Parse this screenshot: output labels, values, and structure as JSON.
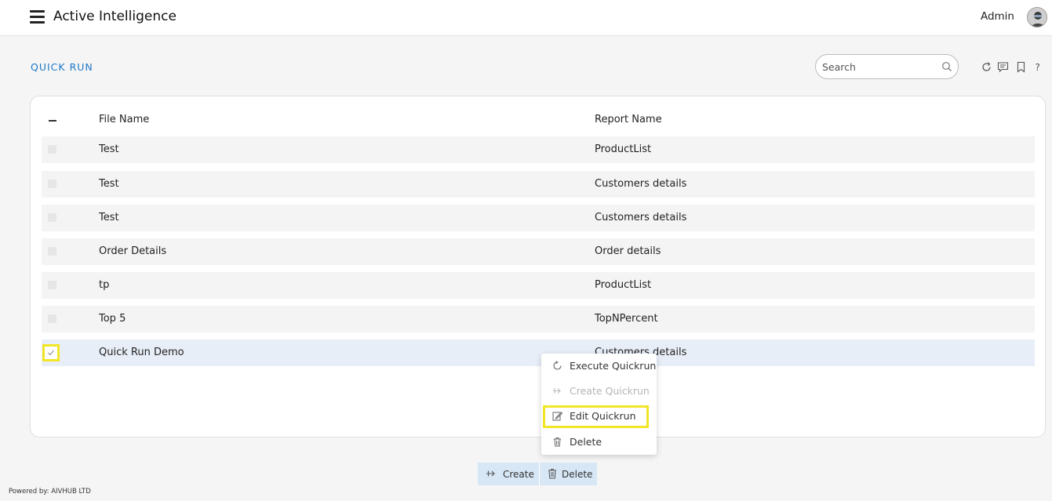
{
  "header": {
    "app_title": "Active Intelligence",
    "user_name": "Admin"
  },
  "page": {
    "title": "QUICK RUN"
  },
  "search": {
    "placeholder": "Search",
    "value": ""
  },
  "table": {
    "columns": [
      "File Name",
      "Report Name"
    ],
    "rows": [
      {
        "file_name": "Test",
        "report_name": "ProductList",
        "checked": false
      },
      {
        "file_name": "Test",
        "report_name": "Customers details",
        "checked": false
      },
      {
        "file_name": "Test",
        "report_name": "Customers details",
        "checked": false
      },
      {
        "file_name": "Order Details",
        "report_name": "Order details",
        "checked": false
      },
      {
        "file_name": "tp",
        "report_name": "ProductList",
        "checked": false
      },
      {
        "file_name": "Top 5",
        "report_name": "TopNPercent",
        "checked": false
      },
      {
        "file_name": "Quick Run Demo",
        "report_name": "Customers details",
        "checked": true
      }
    ]
  },
  "context_menu": {
    "items": [
      {
        "label": "Execute Quickrun",
        "icon": "execute-icon",
        "enabled": true
      },
      {
        "label": "Create Quickrun",
        "icon": "create-icon",
        "enabled": false
      },
      {
        "label": "Edit Quickrun",
        "icon": "edit-icon",
        "enabled": true,
        "highlighted": true
      },
      {
        "label": "Delete",
        "icon": "trash-icon",
        "enabled": true
      }
    ]
  },
  "actions": {
    "create_label": "Create",
    "delete_label": "Delete"
  },
  "footer": {
    "text": "Powered by: AIVHUB LTD"
  },
  "colors": {
    "accent": "#1e78c8",
    "highlight": "#f2e526",
    "selected_row": "#e8eef8",
    "action_bar": "#d7e7f6"
  }
}
